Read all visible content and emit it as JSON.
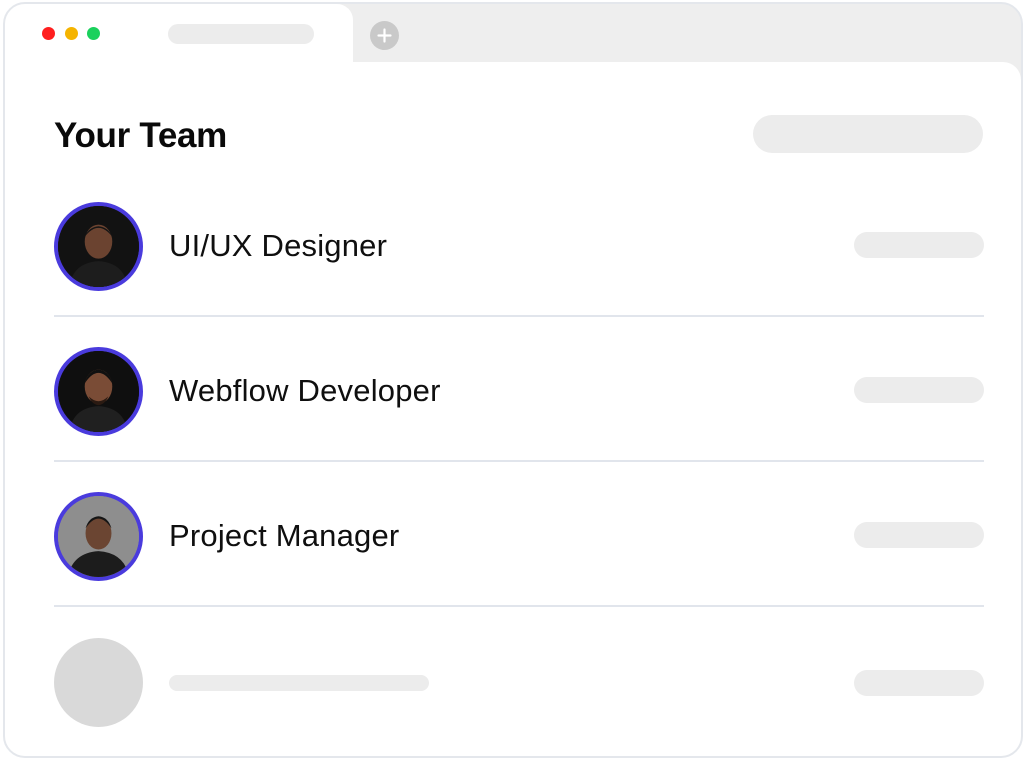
{
  "window": {
    "controls": [
      "close",
      "minimize",
      "maximize"
    ],
    "colors": {
      "close": "#ff1f1f",
      "minimize": "#f5b400",
      "maximize": "#1ad15c"
    },
    "new_tab_icon": "plus-icon"
  },
  "page": {
    "title": "Your Team",
    "accent_color": "#4a3bdd"
  },
  "team": [
    {
      "role": "UI/UX Designer",
      "avatar": "avatar-photo"
    },
    {
      "role": "Webflow Developer",
      "avatar": "avatar-photo"
    },
    {
      "role": "Project Manager",
      "avatar": "avatar-photo"
    }
  ]
}
